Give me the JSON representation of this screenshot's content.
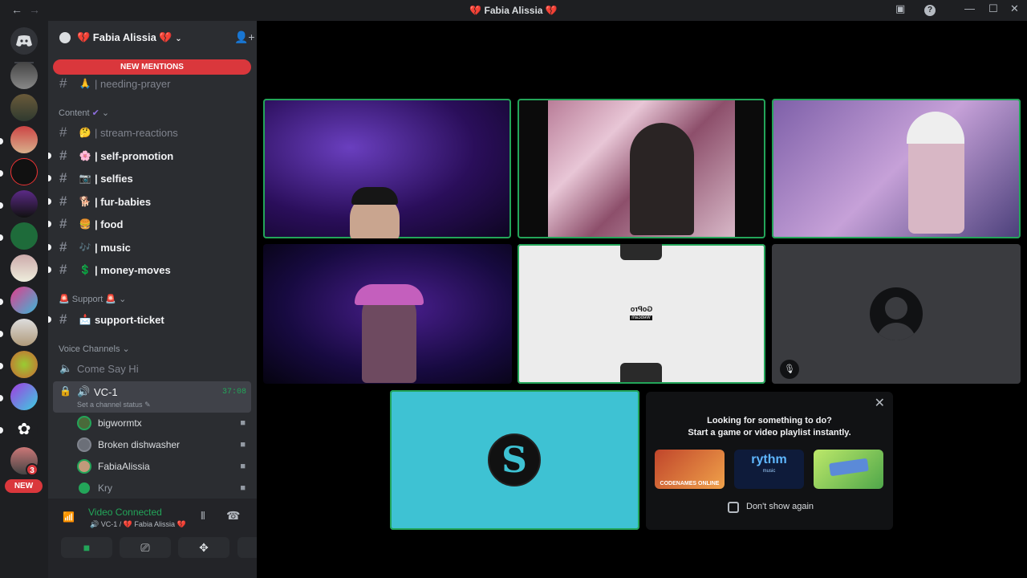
{
  "window": {
    "title": "💔 Fabia Alissia 💔"
  },
  "server": {
    "name": "💔 Fabia Alissia 💔"
  },
  "banner": {
    "new_mentions": "NEW MENTIONS"
  },
  "channels": [
    {
      "emoji": "🙏",
      "name": "| needing-prayer",
      "style": "dim"
    },
    {
      "emoji": "🤔",
      "name": "| stream-reactions",
      "style": "dim"
    },
    {
      "emoji": "🌸",
      "name": "| self-promotion",
      "style": "bright"
    },
    {
      "emoji": "📷",
      "name": "| selfies",
      "style": "bright"
    },
    {
      "emoji": "🐕",
      "name": "| fur-babies",
      "style": "bright"
    },
    {
      "emoji": "🍔",
      "name": "| food",
      "style": "bright"
    },
    {
      "emoji": "🎶",
      "name": "| music",
      "style": "bright"
    },
    {
      "emoji": "💲",
      "name": "| money-moves",
      "style": "bright"
    },
    {
      "emoji": "📩",
      "name": "support-ticket",
      "style": "bright"
    }
  ],
  "categories": {
    "content": "Content",
    "support": "Support",
    "voice": "Voice Channels"
  },
  "voice": {
    "come_say_hi": "Come Say Hi",
    "vc1_name": "VC-1",
    "vc1_timer": "37:08",
    "vc1_status": "Set a channel status",
    "members": [
      "bigwormtx",
      "Broken dishwasher",
      "FabiaAlissia",
      "Kry"
    ]
  },
  "server_badges": {
    "mention_count": "3",
    "new_label": "NEW"
  },
  "panel": {
    "status": "Video Connected",
    "location": "VC-1 / 💔 Fabia Alissia 💔"
  },
  "activity": {
    "line1": "Looking for something to do?",
    "line2": "Start a game or video playlist instantly.",
    "dont_show": "Don't show again",
    "games": [
      "CODENAMES ONLINE",
      "rythm",
      "music"
    ]
  },
  "webcam_text": {
    "gopro": "GoPro",
    "webcam": "Webcam"
  },
  "colors": {
    "accent": "#23a559",
    "mention": "#da373c",
    "cyan_tile": "#3ec2d3"
  }
}
